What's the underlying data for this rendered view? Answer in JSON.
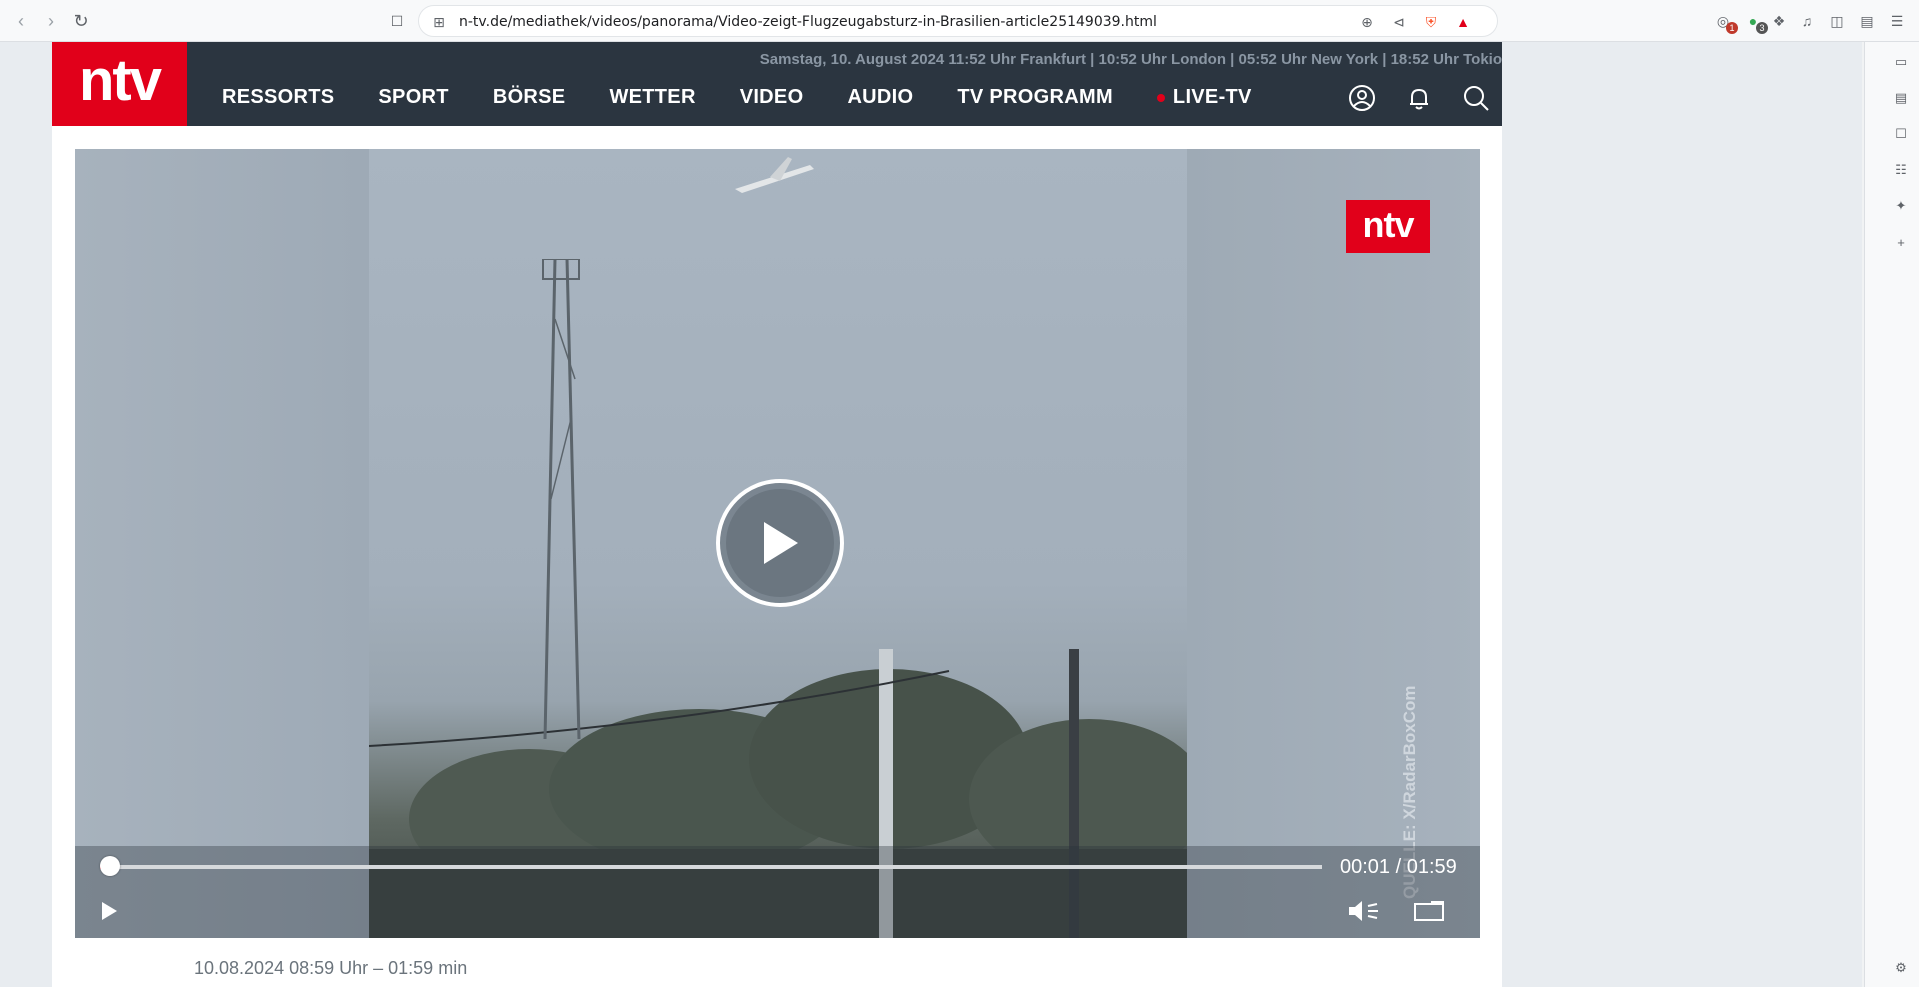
{
  "browser": {
    "url": "n-tv.de/mediathek/videos/panorama/Video-zeigt-Flugzeugabsturz-in-Brasilien-article25149039.html",
    "extension_badges": [
      "1",
      "3"
    ]
  },
  "header": {
    "logo_text": "ntv",
    "dateline": "Samstag, 10. August 2024 11:52 Uhr Frankfurt | 10:52 Uhr London | 05:52 Uhr New York | 18:52 Uhr Tokio",
    "nav": [
      "RESSORTS",
      "SPORT",
      "BÖRSE",
      "WETTER",
      "VIDEO",
      "AUDIO",
      "TV PROGRAMM",
      "LIVE-TV"
    ],
    "icons": [
      "user-icon",
      "bell-icon",
      "search-icon"
    ]
  },
  "video": {
    "watermark_logo": "ntv",
    "credit": "QUELLE: X/RadarBoxCom",
    "time_display": "00:01 / 01:59",
    "progress_fraction": 0.0084
  },
  "meta": {
    "date_duration": "10.08.2024 08:59 Uhr – 01:59 min"
  },
  "colors": {
    "brand_red": "#e1001a",
    "header_bg": "#2b3540"
  }
}
